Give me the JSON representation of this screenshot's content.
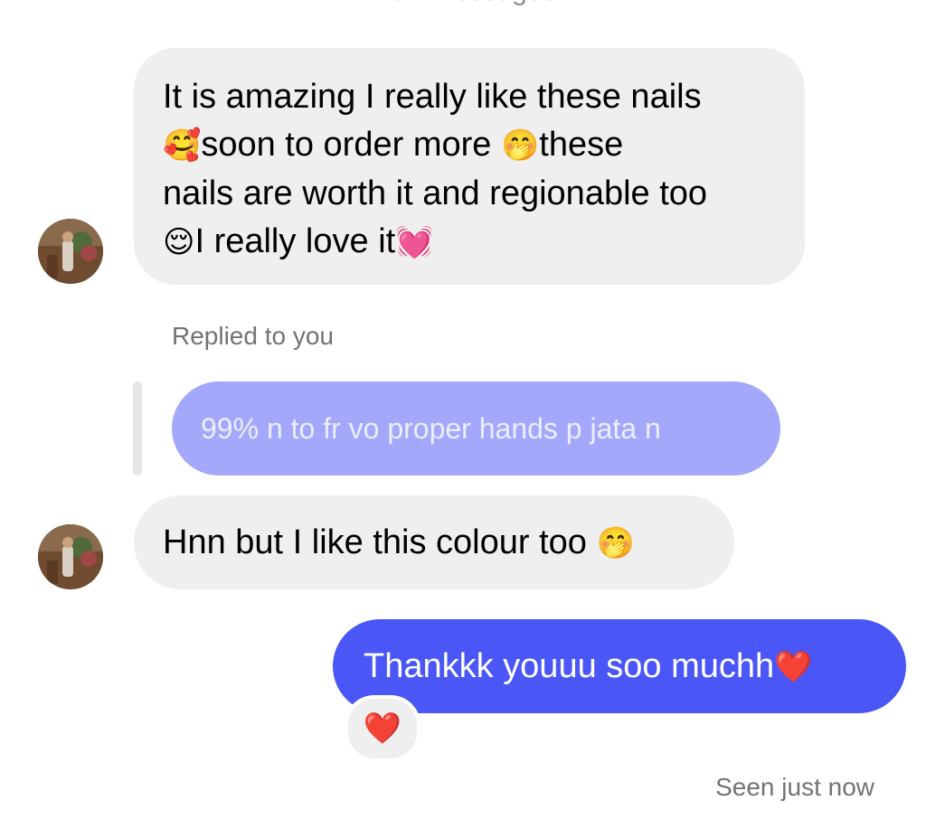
{
  "header": {
    "new_messages_label": "New messages"
  },
  "thread": {
    "message_1": {
      "line_1": "It is amazing I really like these nails",
      "line_2_emoji_a": "🥰",
      "line_2_text_a": "soon to order more ",
      "line_2_emoji_b": "🤭",
      "line_2_text_b": "these",
      "line_3": "nails are worth it and regionable too",
      "line_4_emoji_a": "😌",
      "line_4_text": "I really love it",
      "line_4_emoji_b": "💓"
    },
    "reply_label": "Replied to you",
    "quoted_message": "99% n to fr vo proper hands p jata n",
    "message_2": {
      "text": "Hnn but I like this colour too ",
      "emoji": "🤭"
    },
    "outgoing_message": {
      "text": "Thankkk youuu soo muchh",
      "emoji": "❤️"
    },
    "reaction": "❤️",
    "seen_status": "Seen just now"
  },
  "colors": {
    "incoming_bubble": "#efefef",
    "outgoing_bubble": "#4a56f5",
    "quoted_bubble": "#a3a8fb",
    "secondary_text": "#737373"
  }
}
